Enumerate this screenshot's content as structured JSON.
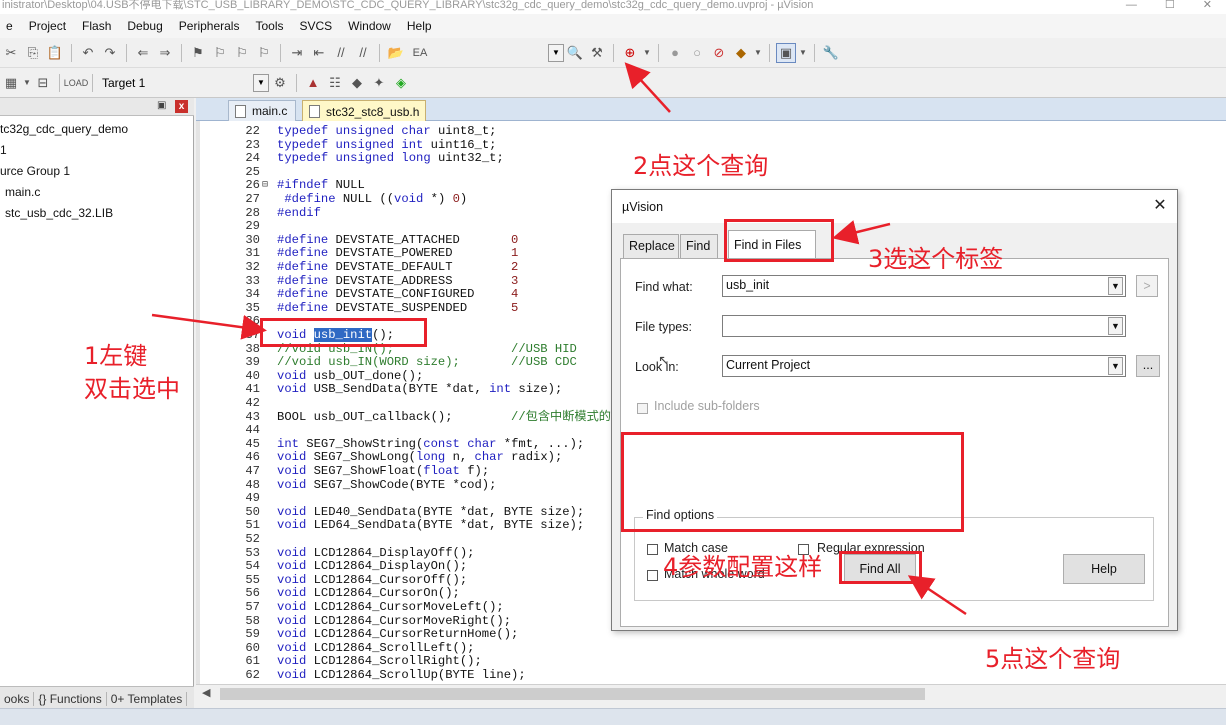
{
  "window": {
    "title": "inistrator\\Desktop\\04.USB不停电下载\\STC_USB_LIBRARY_DEMO\\STC_CDC_QUERY_LIBRARY\\stc32g_cdc_query_demo\\stc32g_cdc_query_demo.uvproj - µVision"
  },
  "menubar": {
    "items": [
      "e",
      "Project",
      "Flash",
      "Debug",
      "Peripherals",
      "Tools",
      "SVCS",
      "Window",
      "Help"
    ]
  },
  "toolbar1": {
    "ea_label": "EA"
  },
  "toolbar2": {
    "target_label": "Target 1"
  },
  "project_panel": {
    "tree": [
      "tc32g_cdc_query_demo",
      "1",
      "urce Group 1",
      "main.c",
      "stc_usb_cdc_32.LIB"
    ],
    "bottom_tabs": [
      "ooks",
      "{} Functions",
      "0+ Templates"
    ]
  },
  "editor": {
    "tabs": [
      "main.c",
      "stc32_stc8_usb.h"
    ],
    "active_tab": "stc32_stc8_usb.h",
    "lines": [
      {
        "n": "22",
        "t": "typedef unsigned char uint8_t;"
      },
      {
        "n": "23",
        "t": "typedef unsigned int uint16_t;"
      },
      {
        "n": "24",
        "t": "typedef unsigned long uint32_t;"
      },
      {
        "n": "25",
        "t": ""
      },
      {
        "n": "26",
        "t": "#ifndef NULL"
      },
      {
        "n": "27",
        "t": " #define NULL ((void *) 0)"
      },
      {
        "n": "28",
        "t": "#endif"
      },
      {
        "n": "29",
        "t": ""
      },
      {
        "n": "30",
        "t": "#define DEVSTATE_ATTACHED       0"
      },
      {
        "n": "31",
        "t": "#define DEVSTATE_POWERED        1"
      },
      {
        "n": "32",
        "t": "#define DEVSTATE_DEFAULT        2"
      },
      {
        "n": "33",
        "t": "#define DEVSTATE_ADDRESS        3"
      },
      {
        "n": "34",
        "t": "#define DEVSTATE_CONFIGURED     4"
      },
      {
        "n": "35",
        "t": "#define DEVSTATE_SUSPENDED      5"
      },
      {
        "n": "36",
        "t": ""
      },
      {
        "n": "37",
        "t": "void usb_init();"
      },
      {
        "n": "38",
        "t": "//void usb_IN();                //USB HID"
      },
      {
        "n": "39",
        "t": "//void usb_IN(WORD size);       //USB CDC"
      },
      {
        "n": "40",
        "t": "void usb_OUT_done();"
      },
      {
        "n": "41",
        "t": "void USB_SendData(BYTE *dat, int size);"
      },
      {
        "n": "42",
        "t": ""
      },
      {
        "n": "43",
        "t": "BOOL usb_OUT_callback();        //包含中断模式的"
      },
      {
        "n": "44",
        "t": ""
      },
      {
        "n": "45",
        "t": "int SEG7_ShowString(const char *fmt, ...);"
      },
      {
        "n": "46",
        "t": "void SEG7_ShowLong(long n, char radix);"
      },
      {
        "n": "47",
        "t": "void SEG7_ShowFloat(float f);"
      },
      {
        "n": "48",
        "t": "void SEG7_ShowCode(BYTE *cod);"
      },
      {
        "n": "49",
        "t": ""
      },
      {
        "n": "50",
        "t": "void LED40_SendData(BYTE *dat, BYTE size);"
      },
      {
        "n": "51",
        "t": "void LED64_SendData(BYTE *dat, BYTE size);"
      },
      {
        "n": "52",
        "t": ""
      },
      {
        "n": "53",
        "t": "void LCD12864_DisplayOff();"
      },
      {
        "n": "54",
        "t": "void LCD12864_DisplayOn();"
      },
      {
        "n": "55",
        "t": "void LCD12864_CursorOff();"
      },
      {
        "n": "56",
        "t": "void LCD12864_CursorOn();"
      },
      {
        "n": "57",
        "t": "void LCD12864_CursorMoveLeft();"
      },
      {
        "n": "58",
        "t": "void LCD12864_CursorMoveRight();"
      },
      {
        "n": "59",
        "t": "void LCD12864_CursorReturnHome();"
      },
      {
        "n": "60",
        "t": "void LCD12864_ScrollLeft();"
      },
      {
        "n": "61",
        "t": "void LCD12864_ScrollRight();"
      },
      {
        "n": "62",
        "t": "void LCD12864_ScrollUp(BYTE line);"
      }
    ],
    "selected_text": "usb_init"
  },
  "dialog": {
    "title": "µVision",
    "tabs": [
      "Replace",
      "Find",
      "Find in Files"
    ],
    "active_tab": "Find in Files",
    "find_what_label": "Find what:",
    "find_what_value": "usb_init",
    "file_types_label": "File types:",
    "file_types_value": "",
    "look_in_label": "Look in:",
    "look_in_value": "Current Project",
    "browse_label": "...",
    "include_subfolders_label": "Include sub-folders",
    "find_options_label": "Find options",
    "match_case_label": "Match case",
    "regex_label": "Regular expression",
    "whole_word_label": "Match whole word",
    "find_all_label": "Find All",
    "help_label": "Help",
    "next_label": ">"
  },
  "annotations": {
    "a1_line1": "1左键",
    "a1_line2": "双击选中",
    "a2": "2点这个查询",
    "a3": "3选这个标签",
    "a4": "4参数配置这样",
    "a5": "5点这个查询",
    "color": "#e8202a"
  },
  "colors": {
    "keyword": "#1f1fc0",
    "comment": "#2e7d2e",
    "number": "#8a1a1a",
    "selection": "#2f69c4",
    "active_tab": "#fff8c8"
  }
}
